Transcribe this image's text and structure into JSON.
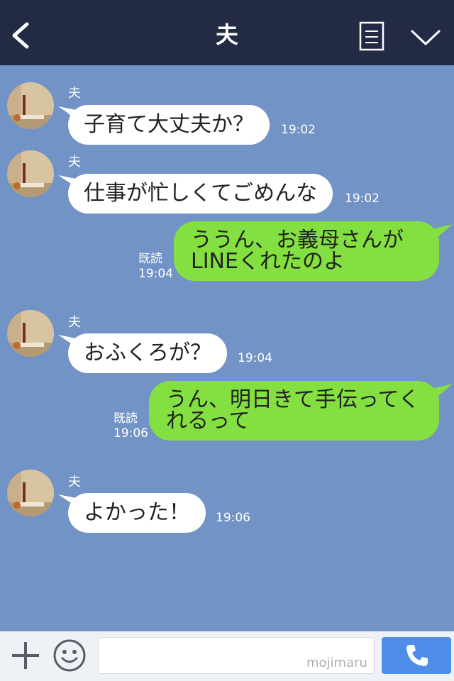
{
  "header": {
    "title": "夫"
  },
  "messages": [
    {
      "sender": "夫",
      "text": "子育て大丈夫か？",
      "time": "19:02"
    },
    {
      "sender": "夫",
      "text": "仕事が忙しくてごめんな",
      "time": "19:02"
    },
    {
      "text": "ううん、お義母さんがLINEくれたのよ",
      "read": "既読",
      "time": "19:04"
    },
    {
      "sender": "夫",
      "text": "おふくろが？",
      "time": "19:04"
    },
    {
      "text": "うん、明日きて手伝ってくれるって",
      "read": "既読",
      "time": "19:06"
    },
    {
      "sender": "夫",
      "text": "よかった！",
      "time": "19:06"
    }
  ],
  "input": {
    "watermark": "mojimaru"
  },
  "colors": {
    "header": "#232a44",
    "background": "#7293c5",
    "outgoing_bubble": "#84e041",
    "incoming_bubble": "#ffffff",
    "call_button": "#4e8ee8"
  },
  "icons": {
    "back": "chevron-left-icon",
    "notes": "notes-icon",
    "menu": "chevron-down-icon",
    "plus": "plus-icon",
    "emoji": "smiley-icon",
    "call": "phone-icon"
  }
}
